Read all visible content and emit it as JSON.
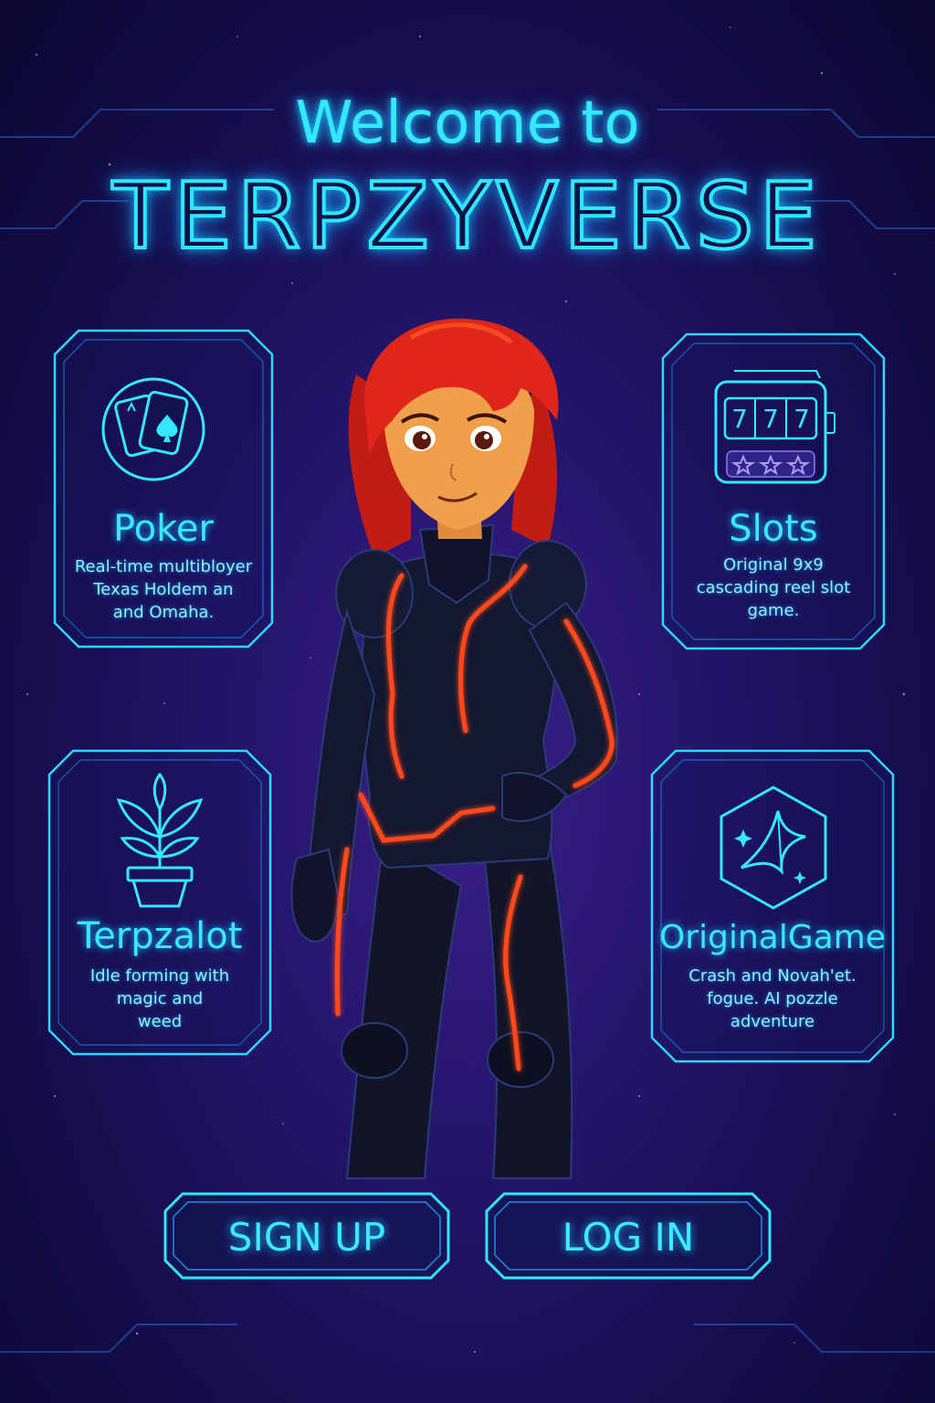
{
  "header": {
    "welcome": "Welcome to",
    "brand": "TERPZYVERSE"
  },
  "games": [
    {
      "label": "Poker",
      "description": "Real-time multibloyer\nTexas Holdem an\nand Omaha.",
      "icon": "playing-cards-icon"
    },
    {
      "label": "Slots",
      "description": "Original 9x9\ncascading reel slot\ngame.",
      "icon": "slot-machine-icon",
      "reel_symbols": [
        "7",
        "7",
        "7"
      ]
    },
    {
      "label": "Terpzalot",
      "description": "Idle forming with\nmagic and\nweed",
      "icon": "potted-plant-icon"
    },
    {
      "label": "OriginalGame",
      "description": "Crash and Novah'et.\nfogue. AI pozzle\nadventure",
      "icon": "crystal-hexagon-icon"
    }
  ],
  "actions": {
    "signup": "SIGN UP",
    "login": "LOG IN"
  },
  "colors": {
    "neon_cyan": "#35e8ff",
    "background": "#1c1260",
    "suit_orange_glow": "#ff4a1c",
    "hair_red": "#e0261a"
  }
}
